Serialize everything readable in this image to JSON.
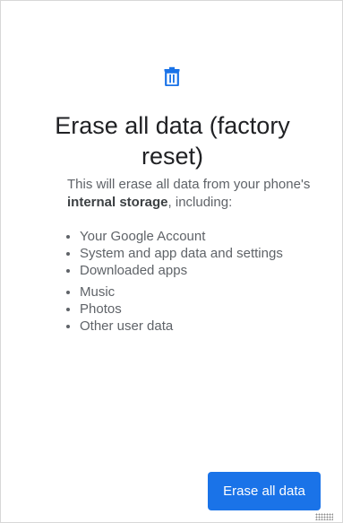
{
  "header": {
    "icon": "trash-icon",
    "accent_color": "#1a73e8"
  },
  "title": "Erase all data (factory reset)",
  "description": {
    "prefix": "This will erase all data from your phone's ",
    "emphasis": "internal storage",
    "suffix": ", including:"
  },
  "items": [
    {
      "label": "Your Google Account"
    },
    {
      "label": "System and app data and settings"
    },
    {
      "label": "Downloaded apps"
    },
    {
      "label": "Music"
    },
    {
      "label": "Photos"
    },
    {
      "label": "Other user data"
    }
  ],
  "actions": {
    "erase_label": "Erase all data"
  }
}
